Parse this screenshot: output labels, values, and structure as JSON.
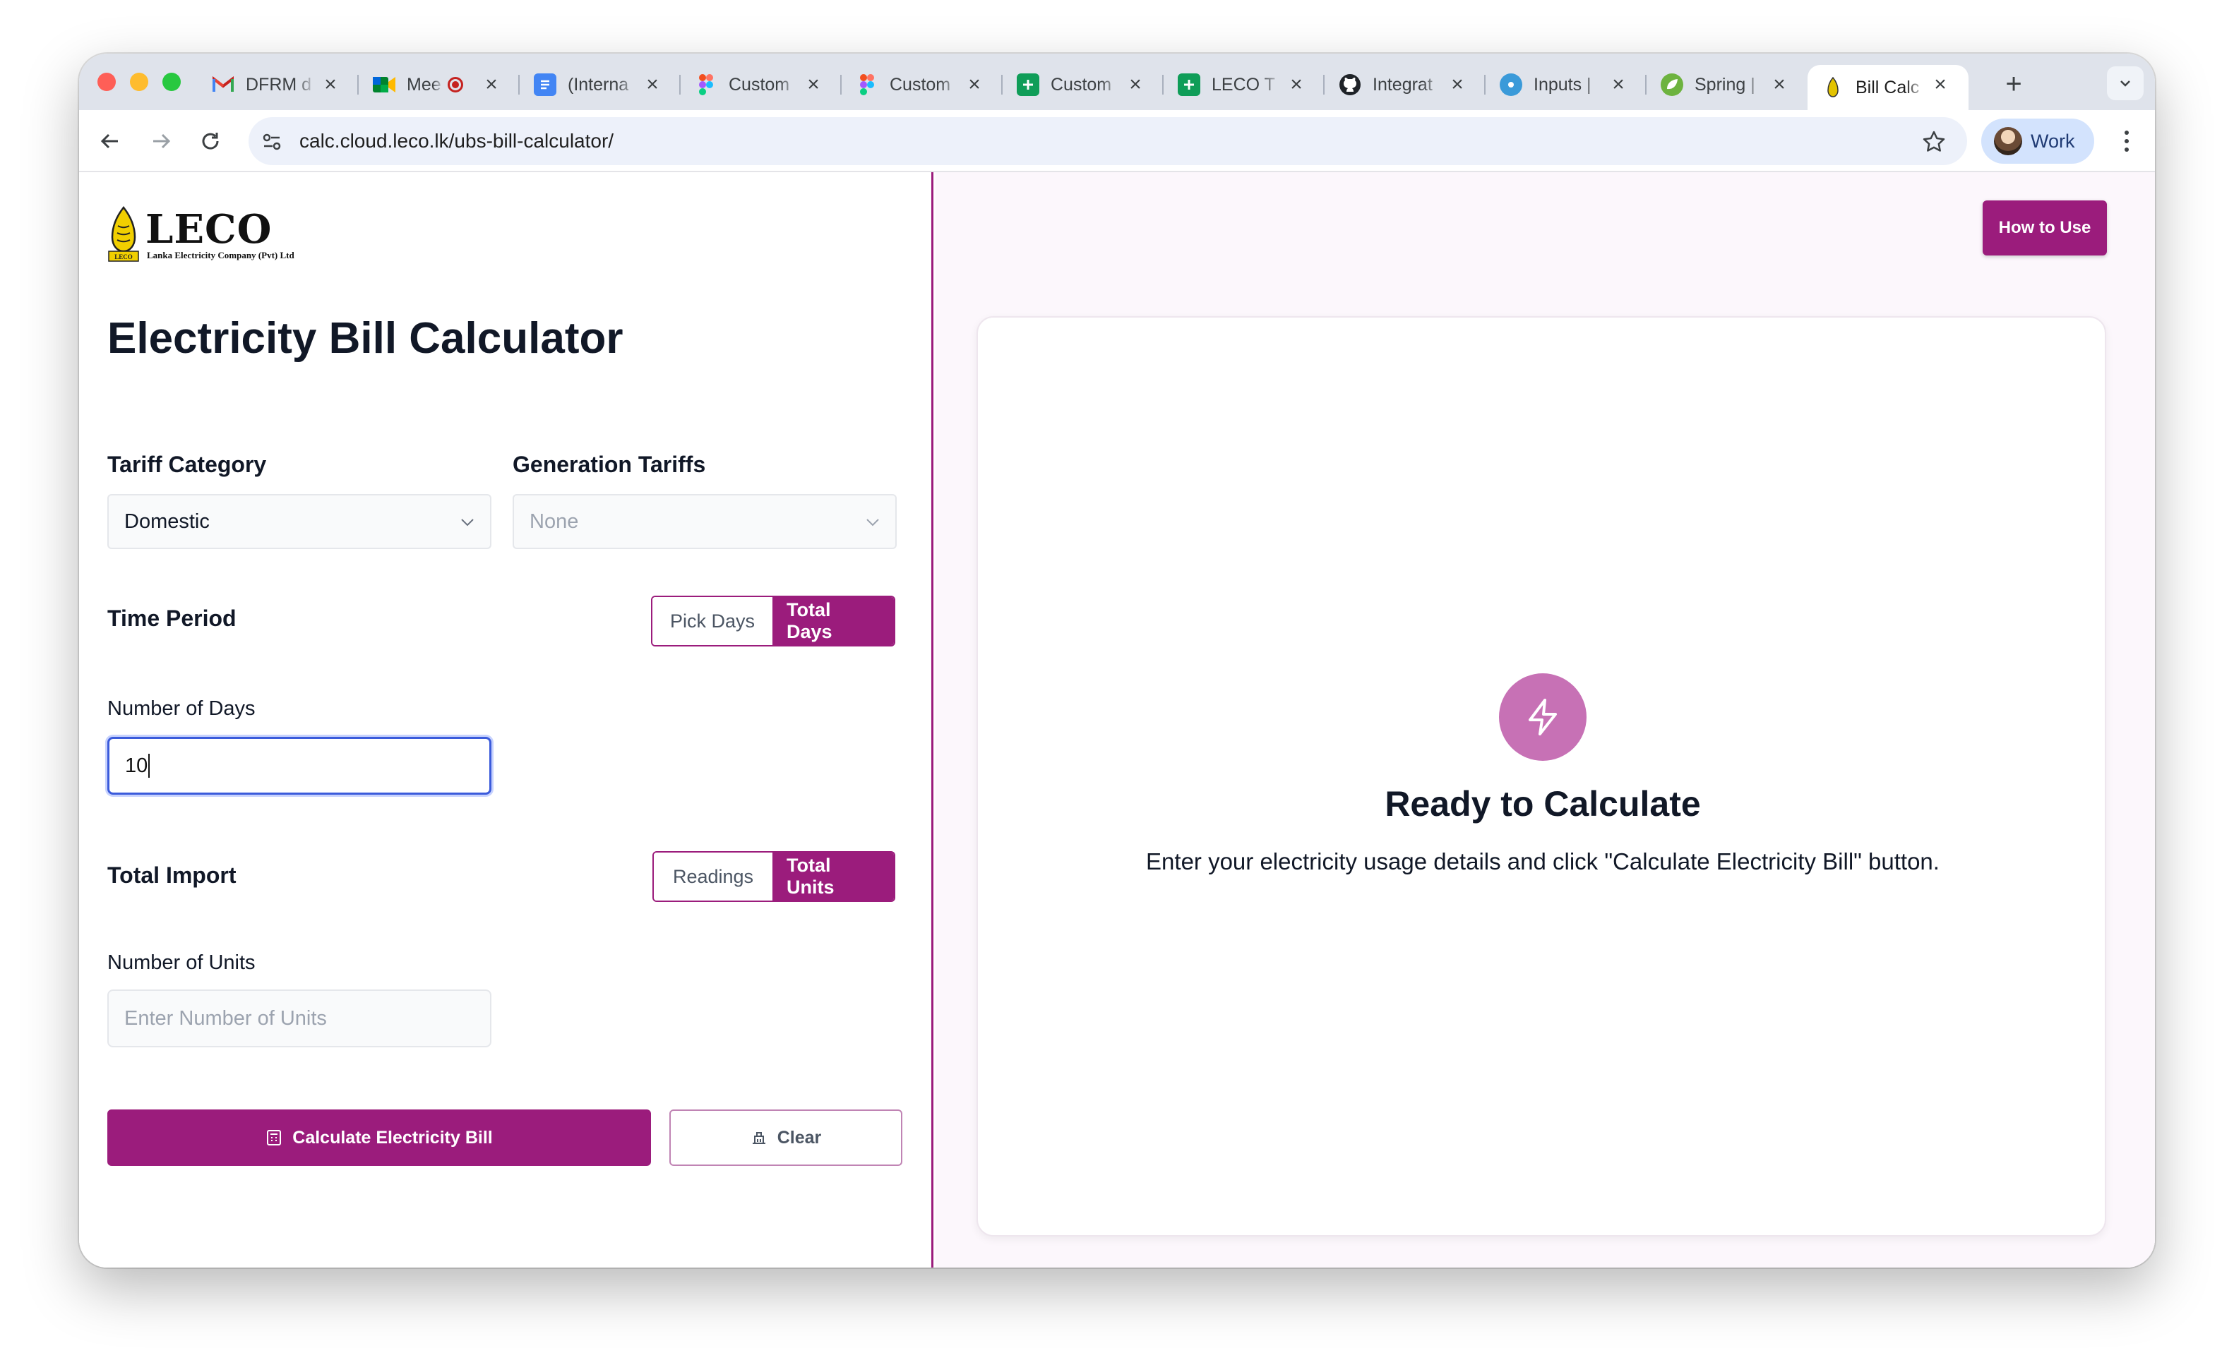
{
  "browser": {
    "tabs": [
      {
        "title": "DFRM d",
        "icon": "gmail-icon"
      },
      {
        "title": "Mee",
        "icon": "meet-icon"
      },
      {
        "title": "(Interna",
        "icon": "docs-icon"
      },
      {
        "title": "Custom",
        "icon": "figma-icon"
      },
      {
        "title": "Custom",
        "icon": "figma-icon"
      },
      {
        "title": "Custom",
        "icon": "sheets-icon"
      },
      {
        "title": "LECO T",
        "icon": "sheets-icon"
      },
      {
        "title": "Integrat",
        "icon": "github-icon"
      },
      {
        "title": "Inputs |",
        "icon": "inputs-icon"
      },
      {
        "title": "Spring |",
        "icon": "spring-icon"
      },
      {
        "title": "Bill Calc",
        "icon": "leco-icon",
        "active": true
      }
    ],
    "url": "calc.cloud.leco.lk/ubs-bill-calculator/",
    "profile_label": "Work"
  },
  "brand": {
    "name": "LECO",
    "subtitle": "Lanka Electricity Company (Pvt) Ltd",
    "tag": "LECO"
  },
  "form": {
    "title": "Electricity Bill Calculator",
    "tariff_category_label": "Tariff Category",
    "tariff_category_value": "Domestic",
    "generation_tariffs_label": "Generation Tariffs",
    "generation_tariffs_value": "None",
    "time_period_label": "Time Period",
    "time_toggle": {
      "option_a": "Pick Days",
      "option_b": "Total Days",
      "selected": "Total Days"
    },
    "days_label": "Number of Days",
    "days_value": "10",
    "total_import_label": "Total Import",
    "import_toggle": {
      "option_a": "Readings",
      "option_b": "Total Units",
      "selected": "Total Units"
    },
    "units_label": "Number of Units",
    "units_placeholder": "Enter Number of Units",
    "calculate_label": "Calculate Electricity Bill",
    "clear_label": "Clear"
  },
  "result": {
    "how_to_label": "How to Use",
    "ready_title": "Ready to Calculate",
    "ready_desc": "Enter your electricity usage details and click \"Calculate Electricity Bill\" button."
  },
  "colors": {
    "brand": "#9b1c7c",
    "icon_circle": "#c771b5",
    "panel_bg": "#fcf7fc"
  }
}
